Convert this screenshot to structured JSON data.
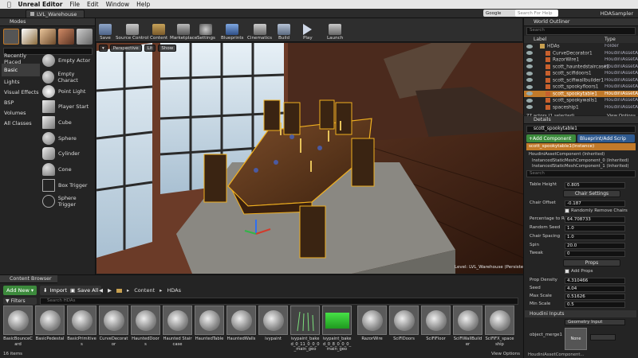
{
  "macbar": {
    "app": "Unreal Editor",
    "menus": [
      "File",
      "Edit",
      "Window",
      "Help"
    ],
    "search_placeholder": "Search For Help"
  },
  "tabs": {
    "level": "LVL_Warehouse",
    "project": "HDASampler"
  },
  "modes": {
    "title": "Modes",
    "categories": [
      "Recently Placed",
      "Basic",
      "Lights",
      "Visual Effects",
      "BSP",
      "Volumes",
      "All Classes"
    ],
    "items": [
      "Empty Actor",
      "Empty Charact",
      "Point Light",
      "Player Start",
      "Cube",
      "Sphere",
      "Cylinder",
      "Cone",
      "Box Trigger",
      "Sphere Trigger"
    ]
  },
  "toolbar": {
    "buttons": [
      "Save",
      "Source Control",
      "Content",
      "Marketplace",
      "Settings",
      "Blueprints",
      "Cinematics",
      "Build",
      "Play",
      "Launch"
    ]
  },
  "viewport": {
    "view_mode": "Perspective",
    "lit": "Lit",
    "show": "Show",
    "level_label": "Level:  LVL_Warehouse (Persistent)"
  },
  "outliner": {
    "title": "World Outliner",
    "search_placeholder": "Search",
    "col_label": "Label",
    "col_type": "Type",
    "rows": [
      {
        "label": "HDAs",
        "type": "Folder"
      },
      {
        "label": "CurveDecorator1",
        "type": "HoudiniAssetA"
      },
      {
        "label": "RazorWire1",
        "type": "HoudiniAssetA"
      },
      {
        "label": "scott_hauntedstaircase2",
        "type": "HoudiniAssetA"
      },
      {
        "label": "scott_scifidoors1",
        "type": "HoudiniAssetA"
      },
      {
        "label": "scott_scifiwallbuilder1",
        "type": "HoudiniAssetA"
      },
      {
        "label": "scott_spookyfloors1",
        "type": "HoudiniAssetA"
      },
      {
        "label": "scott_spookytable1",
        "type": "HoudiniAssetA"
      },
      {
        "label": "scott_spookywalls1",
        "type": "HoudiniAssetA"
      },
      {
        "label": "spaceship1",
        "type": "HoudiniAssetA"
      }
    ],
    "status": "77 actors (1 selected)",
    "view_options": "View Options"
  },
  "details": {
    "title": "Details",
    "actor_name": "scott_spookytable1",
    "add_component": "+Add Component",
    "blueprint": "Blueprint/Add Scrip",
    "instance": "scott_spookytable1(Instance)",
    "components": [
      "HoudiniAssetComponent (Inherited)",
      "InstancedStaticMeshComponent_0 (Inherited)",
      "InstancedStaticMeshComponent_1 (Inherited)"
    ],
    "search_placeholder": "Search",
    "table_height": {
      "label": "Table Height",
      "value": "0.805"
    },
    "chair_section": "Chair Settings",
    "chair_offset": {
      "label": "Chair Offset",
      "value": "-0.187"
    },
    "random_remove": "Randomly Remove Chairs",
    "percentage": {
      "label": "Percentage to Rem",
      "value": "64.708733"
    },
    "random_seed": {
      "label": "Random Seed",
      "value": "1.0"
    },
    "chair_spacing": {
      "label": "Chair Spacing",
      "value": "1.0"
    },
    "spin": {
      "label": "Spin",
      "value": "20.0"
    },
    "tweak": {
      "label": "Tweak",
      "value": "0"
    },
    "props_section": "Props",
    "add_props": "Add Props",
    "prop_density": {
      "label": "Prop Density",
      "value": "4.310466"
    },
    "seed": {
      "label": "Seed",
      "value": "4.04"
    },
    "max_scale": {
      "label": "Max Scale",
      "value": "0.51626"
    },
    "min_scale": {
      "label": "Min Scale",
      "value": "0.5"
    },
    "houdini_inputs": "Houdini Inputs",
    "geometry_input": "Geometry Input",
    "object_merge": "object_merge1",
    "none_label": "None",
    "footer": "HoudiniAssetComponent..."
  },
  "content": {
    "title": "Content Browser",
    "add_new": "Add New",
    "import": "Import",
    "save_all": "Save All",
    "breadcrumb": [
      "Content",
      "HDAs"
    ],
    "filters": "Filters",
    "search_placeholder": "Search HDAs",
    "assets": [
      "BasicBounceCard",
      "BasicPedestal",
      "BasicPrimitives",
      "CurveDecorator",
      "HauntedDoors",
      "Haunted Staircase",
      "HauntedTable",
      "HauntedWalls",
      "ivypaint",
      "ivypaint_baked_0_11_0_0_0_main_geo",
      "ivypaint_baked_0_8_0_0_0_main_geo",
      "RazorWire",
      "SciFiDoors",
      "SciFiFloor",
      "SciFiWallBuilder",
      "SciFiFX_spaceship"
    ],
    "count": "16 items",
    "view_options": "View Options"
  }
}
